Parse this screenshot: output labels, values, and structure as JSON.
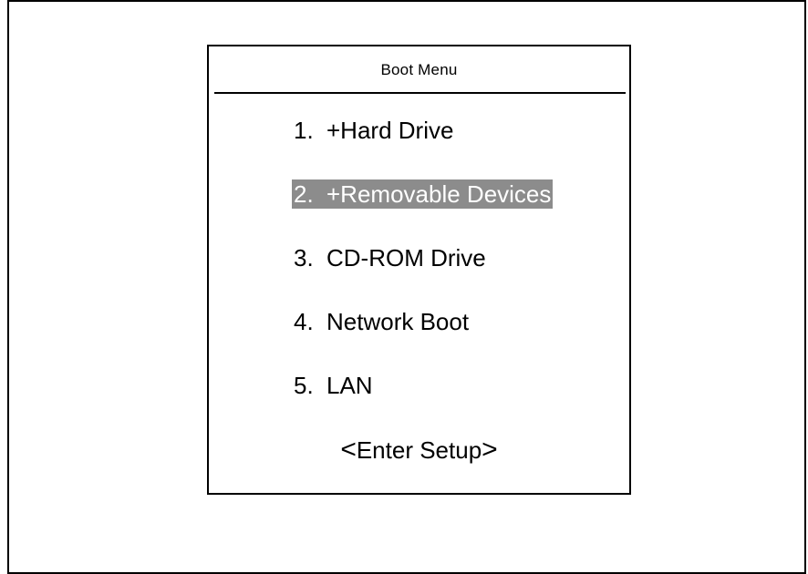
{
  "boot_menu": {
    "title": "Boot Menu",
    "items": [
      {
        "number": "1.",
        "label": "+Hard Drive",
        "selected": false
      },
      {
        "number": "2.",
        "label": "+Removable Devices",
        "selected": true
      },
      {
        "number": "3.",
        "label": "CD-ROM Drive",
        "selected": false
      },
      {
        "number": "4.",
        "label": "Network Boot",
        "selected": false
      },
      {
        "number": "5.",
        "label": "LAN",
        "selected": false
      }
    ],
    "enter_setup": {
      "open": "<",
      "label": "Enter Setup",
      "close": ">"
    }
  },
  "colors": {
    "highlight_background": "#8c8c8c",
    "highlight_text": "#ffffff",
    "border": "#000000",
    "background": "#ffffff"
  }
}
